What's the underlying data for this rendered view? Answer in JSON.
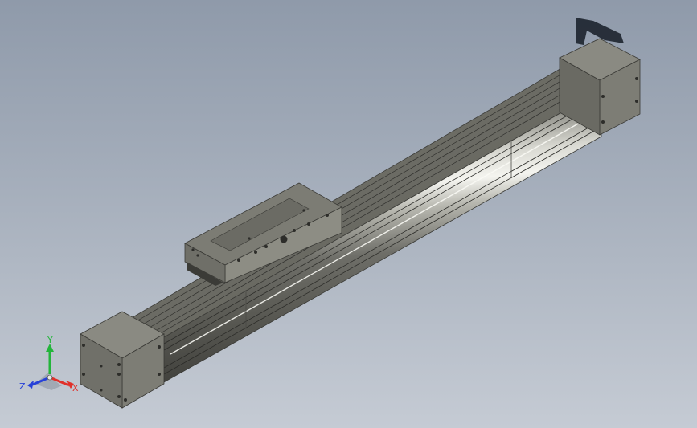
{
  "triad": {
    "x_label": "X",
    "y_label": "Y",
    "z_label": "Z",
    "x_color": "#e0302a",
    "y_color": "#22b53a",
    "z_color": "#2741d8"
  },
  "model": {
    "body_color": "#8c8c80",
    "body_dark": "#6f6f66",
    "body_light": "#a8a89c",
    "rail_highlight": "#f1f1ec",
    "shadow_color": "#1e2630"
  }
}
